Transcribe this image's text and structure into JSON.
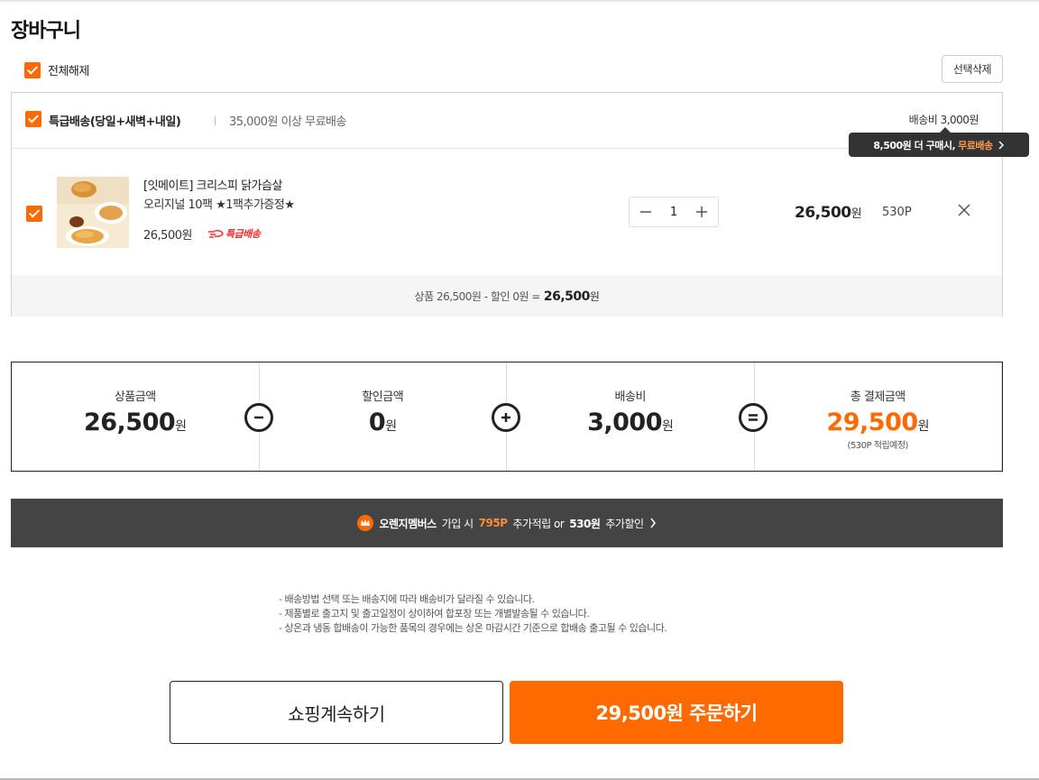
{
  "page": {
    "title": "장바구니"
  },
  "selection": {
    "toggle_label": "전체해제",
    "delete_label": "선택삭제"
  },
  "group": {
    "name": "특급배송(당일+새벽+내일)",
    "condition": "35,000원 이상 무료배송",
    "shipping_fee": "배송비 3,000원",
    "tooltip": {
      "prefix": "8,500원 더 구매시,",
      "highlight": "무료배송"
    }
  },
  "item": {
    "title": "[잇메이트] 크리스피 닭가슴살",
    "subtitle": "오리지널 10팩 ★1팩추가증정★",
    "unit_price": "26,500원",
    "badge": "특급배송",
    "quantity": "1",
    "line_total": "26,500",
    "line_total_unit": "원",
    "points": "530P",
    "image_icon": "food-photo-icon"
  },
  "group_summary": {
    "text": "상품 26,500원 - 할인 0원 =",
    "total": "26,500",
    "unit": "원"
  },
  "totals": {
    "product": {
      "label": "상품금액",
      "value": "26,500",
      "unit": "원"
    },
    "discount": {
      "label": "할인금액",
      "value": "0",
      "unit": "원"
    },
    "shipping": {
      "label": "배송비",
      "value": "3,000",
      "unit": "원"
    },
    "grand": {
      "label": "총 결제금액",
      "value": "29,500",
      "unit": "원",
      "note": "(530P 적립예정)"
    }
  },
  "promo": {
    "brand": "오렌지멤버스",
    "text1": "가입 시",
    "points": "795P",
    "text2": "추가적립 or",
    "discount": "530원",
    "text3": "추가할인"
  },
  "notes": [
    "- 배송방법 선택 또는 배송지에 따라 배송비가 달라질 수 있습니다.",
    "- 제품별로 출고지 및 출고일정이 상이하여 합포장 또는 개별발송될 수 있습니다.",
    "- 상온과 냉동 합배송이 가능한 품목의 경우에는 상온 마감시간 기준으로 합배송 출고될 수 있습니다."
  ],
  "actions": {
    "continue_label": "쇼핑계속하기",
    "order_label": "29,500원 주문하기"
  },
  "colors": {
    "accent": "#ff6a00",
    "dark_banner": "#444444",
    "badge_red": "#ff2b2b"
  }
}
